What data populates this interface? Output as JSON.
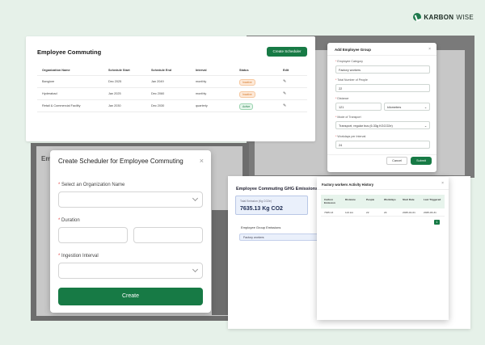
{
  "brand": {
    "name_bold": "KARBON",
    "name_light": "WISE"
  },
  "commuting_panel": {
    "title": "Employee Commuting",
    "create_button": "Create Scheduler",
    "columns": [
      "Organization Name",
      "Schedule Start",
      "Schedule End",
      "Interval",
      "Status",
      "Edit"
    ],
    "rows": [
      {
        "org": "Bangiore",
        "start": "Dec 2025",
        "end": "Jan 2049",
        "interval": "monthly",
        "status": "Inactive"
      },
      {
        "org": "Hyderabad",
        "start": "Jan 2025",
        "end": "Dec 2060",
        "interval": "monthly",
        "status": "Inactive"
      },
      {
        "org": "Retail & Commercial Facility",
        "start": "Jan 2030",
        "end": "Dec 2030",
        "interval": "quarterly",
        "status": "Active"
      }
    ],
    "colors": {
      "accent": "#177a45",
      "inactive": "#d77a2a",
      "active": "#1d7a45"
    }
  },
  "add_group_modal": {
    "title": "Add Employee Group",
    "category_label": "Employee Category",
    "category_value": "Factory workers",
    "people_label": "Total Number of People",
    "people_value": "22",
    "distance_label": "Distance",
    "distance_value": "121",
    "distance_unit": "kilometers",
    "transport_label": "Mode of Transport",
    "transport_value": "Transport, regular bus (6.33g KGCO2e)",
    "workdays_label": "Workdays per Interval",
    "workdays_value": "24",
    "cancel": "Cancel",
    "submit": "Submit"
  },
  "background_ghost_title": "Em",
  "scheduler_modal": {
    "title": "Create Scheduler for Employee Commuting",
    "org_label": "Select an Organization Name",
    "duration_label": "Duration",
    "interval_label": "Ingestion Interval",
    "create": "Create",
    "required_mark": "*"
  },
  "emissions_panel": {
    "title": "Employee Commuting GHG Emissions",
    "card_label": "Total Emission (Kg CO2e)",
    "card_value": "7635.13 Kg CO2",
    "group_title": "Employee Group Emissions",
    "group_item": "Factory workers"
  },
  "history_modal": {
    "title": "Factory workers Activity History",
    "columns": [
      "Carbon Emission",
      "Distance",
      "People",
      "Workdays",
      "Start Date",
      "Last Triggered"
    ],
    "rows": [
      {
        "emission": "7635.13",
        "distance": "121 km",
        "people": "22",
        "workdays": "24",
        "start": "2025-01-01",
        "last": "2025-03-31"
      }
    ],
    "page": "1"
  }
}
